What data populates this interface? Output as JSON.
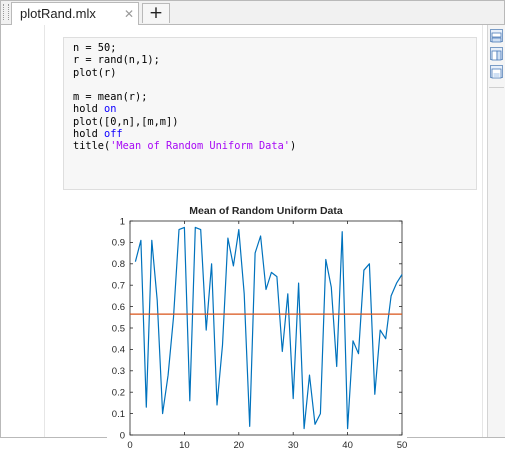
{
  "tabs": [
    {
      "label": "plotRand.mlx",
      "close_glyph": "✕"
    }
  ],
  "new_tab_glyph": "+",
  "code_lines": [
    [
      {
        "t": "n = 50;"
      }
    ],
    [
      {
        "t": "r = rand(n,1);"
      }
    ],
    [
      {
        "t": "plot(r)"
      }
    ],
    [
      {
        "t": ""
      }
    ],
    [
      {
        "t": "m = mean(r);"
      }
    ],
    [
      {
        "t": "hold "
      },
      {
        "t": "on",
        "c": "kw"
      }
    ],
    [
      {
        "t": "plot([0,n],[m,m])"
      }
    ],
    [
      {
        "t": "hold "
      },
      {
        "t": "off",
        "c": "kw"
      }
    ],
    [
      {
        "t": "title("
      },
      {
        "t": "'Mean of Random Uniform Data'",
        "c": "str"
      },
      {
        "t": ")"
      }
    ]
  ],
  "sidebar_icons": [
    "output-inline-icon",
    "output-right-icon",
    "hide-code-icon"
  ],
  "chart_data": {
    "type": "line",
    "title": "Mean of Random Uniform Data",
    "xlabel": "",
    "ylabel": "",
    "xlim": [
      0,
      50
    ],
    "ylim": [
      0,
      1
    ],
    "xticks": [
      0,
      10,
      20,
      30,
      40,
      50
    ],
    "yticks": [
      0,
      0.1,
      0.2,
      0.3,
      0.4,
      0.5,
      0.6,
      0.7,
      0.8,
      0.9,
      1
    ],
    "grid": false,
    "series": [
      {
        "color": "#0072BD",
        "x": [
          1,
          2,
          3,
          4,
          5,
          6,
          7,
          8,
          9,
          10,
          11,
          12,
          13,
          14,
          15,
          16,
          17,
          18,
          19,
          20,
          21,
          22,
          23,
          24,
          25,
          26,
          27,
          28,
          29,
          30,
          31,
          32,
          33,
          34,
          35,
          36,
          37,
          38,
          39,
          40,
          41,
          42,
          43,
          44,
          45,
          46,
          47,
          48,
          49,
          50
        ],
        "y": [
          0.81,
          0.91,
          0.13,
          0.91,
          0.63,
          0.1,
          0.28,
          0.55,
          0.96,
          0.97,
          0.16,
          0.97,
          0.96,
          0.49,
          0.8,
          0.14,
          0.42,
          0.92,
          0.79,
          0.96,
          0.66,
          0.04,
          0.85,
          0.93,
          0.68,
          0.76,
          0.74,
          0.39,
          0.66,
          0.17,
          0.71,
          0.03,
          0.28,
          0.05,
          0.1,
          0.82,
          0.69,
          0.32,
          0.95,
          0.03,
          0.44,
          0.38,
          0.77,
          0.8,
          0.19,
          0.49,
          0.45,
          0.65,
          0.71,
          0.75
        ]
      },
      {
        "color": "#D95319",
        "x": [
          0,
          50
        ],
        "y": [
          0.565,
          0.565
        ]
      }
    ]
  }
}
